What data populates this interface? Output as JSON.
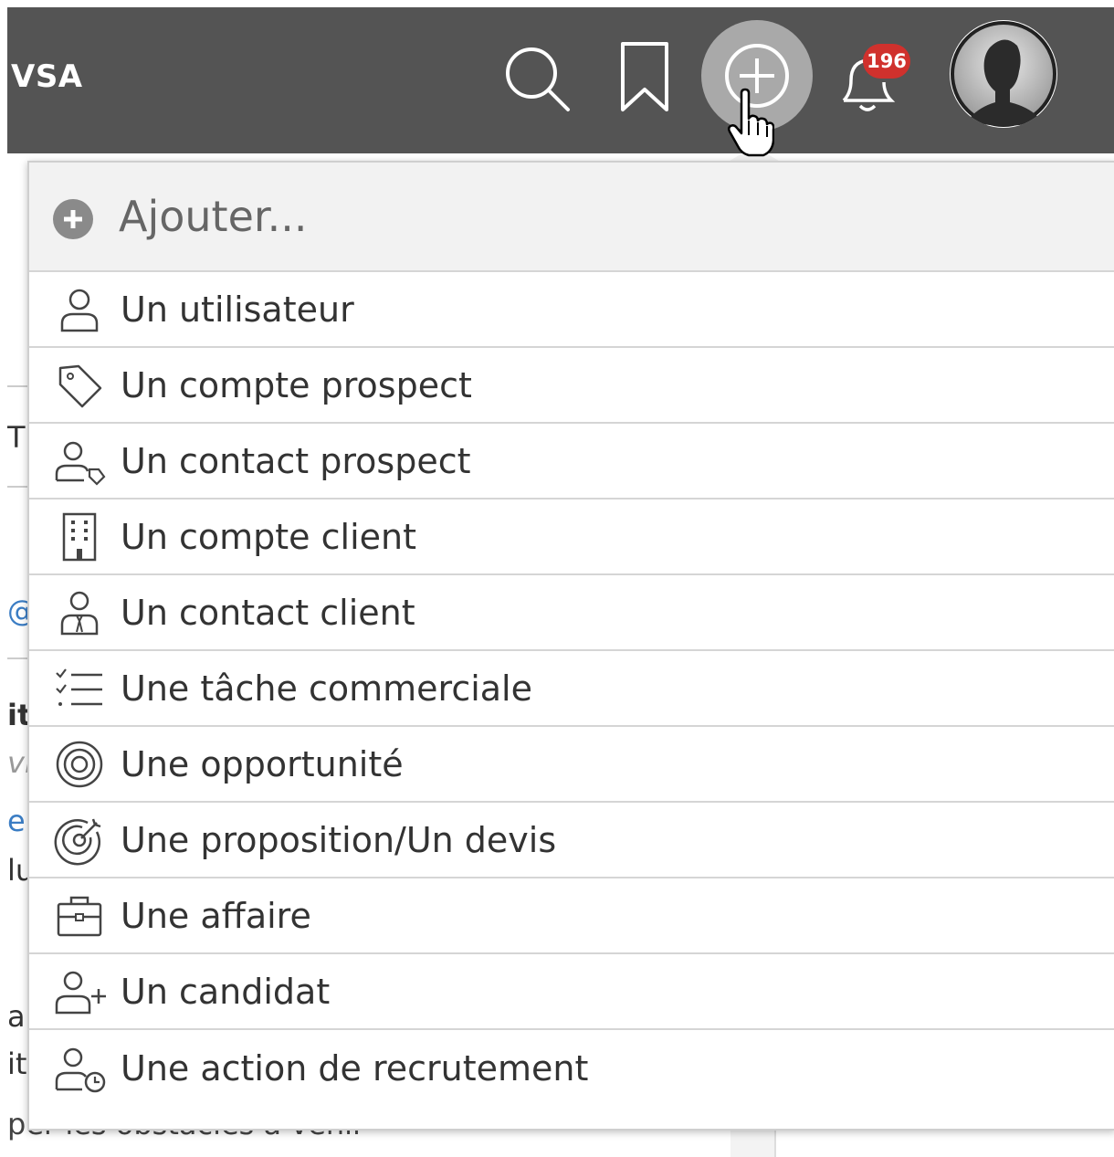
{
  "header": {
    "brand": "VSA",
    "notification_count": "196"
  },
  "icons": {
    "search": "search-icon",
    "bookmark": "bookmark-icon",
    "add": "add-circle-icon",
    "notifications": "bell-icon",
    "avatar": "user-avatar"
  },
  "colors": {
    "topbar": "#545454",
    "badge": "#d0312d",
    "add_button_bg": "#a9a9a9"
  },
  "background_fragments": {
    "frag1": "T",
    "frag2": "@",
    "frag3": "it",
    "frag4": "vi",
    "frag5": "e",
    "frag6": "lu",
    "frag7": "a",
    "frag8": "it",
    "bottom": "per les obstacles à venir"
  },
  "dropdown": {
    "title": "Ajouter...",
    "items": [
      {
        "label": "Un utilisateur",
        "icon": "user-icon"
      },
      {
        "label": "Un compte prospect",
        "icon": "tag-icon"
      },
      {
        "label": "Un contact prospect",
        "icon": "user-tag-icon"
      },
      {
        "label": "Un compte client",
        "icon": "building-icon"
      },
      {
        "label": "Un contact client",
        "icon": "user-tie-icon"
      },
      {
        "label": "Une tâche commerciale",
        "icon": "checklist-icon"
      },
      {
        "label": "Une opportunité",
        "icon": "target-icon"
      },
      {
        "label": "Une proposition/Un devis",
        "icon": "target-dart-icon"
      },
      {
        "label": "Une affaire",
        "icon": "briefcase-icon"
      },
      {
        "label": "Un candidat",
        "icon": "user-plus-icon"
      },
      {
        "label": "Une action de recrutement",
        "icon": "user-clock-icon"
      }
    ]
  }
}
